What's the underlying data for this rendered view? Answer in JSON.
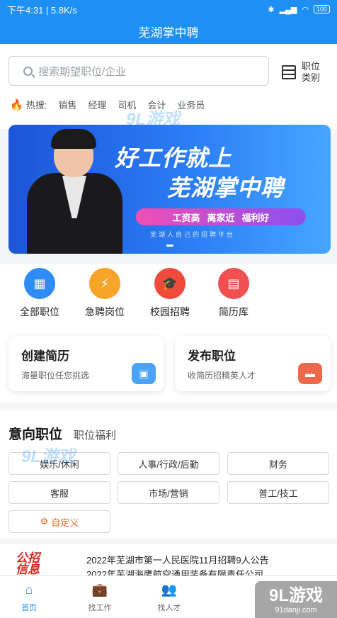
{
  "status_bar": {
    "time_speed": "下午4:31 | 5.8K/s",
    "battery": "100"
  },
  "app_title": "芜湖掌中聘",
  "search": {
    "placeholder": "搜索期望职位/企业"
  },
  "category_button": {
    "line1": "职位",
    "line2": "类别"
  },
  "hot_search": {
    "label": "热搜:",
    "terms": [
      "销售",
      "经理",
      "司机",
      "会计",
      "业务员"
    ]
  },
  "banner": {
    "headline_1": "好工作就上",
    "headline_2": "芜湖掌中聘",
    "pill_items": [
      "工资高",
      "离家近",
      "福利好"
    ],
    "sub": "芜湖人自己的招聘平台"
  },
  "quick_nav": [
    {
      "label": "全部职位",
      "icon": "grid-icon",
      "color": "#2f8cf5"
    },
    {
      "label": "急聘岗位",
      "icon": "briefcase-icon",
      "color": "#f7a52a"
    },
    {
      "label": "校园招聘",
      "icon": "graduation-cap-icon",
      "color": "#ef4b3c"
    },
    {
      "label": "简历库",
      "icon": "drawer-icon",
      "color": "#f15050"
    }
  ],
  "cards": [
    {
      "title": "创建简历",
      "desc": "海量职位任您挑选",
      "icon": "resume-icon",
      "color": "#4aa3f7"
    },
    {
      "title": "发布职位",
      "desc": "收简历招精英人才",
      "icon": "briefcase-icon",
      "color": "#f0684c"
    }
  ],
  "intent": {
    "tab_active": "意向职位",
    "tab_other": "职位福利",
    "chips": [
      "娱乐/休闲",
      "人事/行政/后勤",
      "财务",
      "客服",
      "市场/营销",
      "普工/技工"
    ],
    "custom": "自定义"
  },
  "news": {
    "logo_line1": "公招",
    "logo_line2": "信息",
    "items": [
      "2022年芜湖市第一人民医院11月招聘9人公告",
      "2022年芜湖海鹰航空通用装备有限责任公司"
    ]
  },
  "bottom_nav": [
    {
      "label": "首页",
      "icon": "home-icon",
      "active": true
    },
    {
      "label": "找工作",
      "icon": "briefcase-icon",
      "active": false
    },
    {
      "label": "找人才",
      "icon": "people-icon",
      "active": false
    }
  ],
  "watermark": {
    "brand": "9L游戏",
    "url": "91danji.com"
  }
}
